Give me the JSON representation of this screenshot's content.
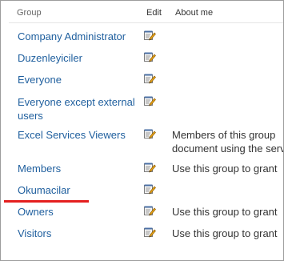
{
  "header": {
    "group_label": "Group",
    "edit_label": "Edit",
    "about_label": "About me"
  },
  "rows": [
    {
      "name": "Company Administrator",
      "about": []
    },
    {
      "name": "Duzenleyiciler",
      "about": []
    },
    {
      "name": "Everyone",
      "about": []
    },
    {
      "name_lines": [
        "Everyone except external",
        "users"
      ],
      "about": []
    },
    {
      "name": "Excel Services Viewers",
      "about": [
        "Members of this group",
        "document using the serv"
      ]
    },
    {
      "name": "Members",
      "about": [
        "Use this group to grant"
      ]
    },
    {
      "name": "Okumacilar",
      "about": []
    },
    {
      "name": "Owners",
      "about": [
        "Use this group to grant"
      ]
    },
    {
      "name": "Visitors",
      "about": [
        "Use this group to grant"
      ]
    }
  ],
  "icons": {
    "edit": "edit-pencil-icon"
  },
  "colors": {
    "link": "#1f5f9e",
    "highlight": "#e41f1f"
  }
}
